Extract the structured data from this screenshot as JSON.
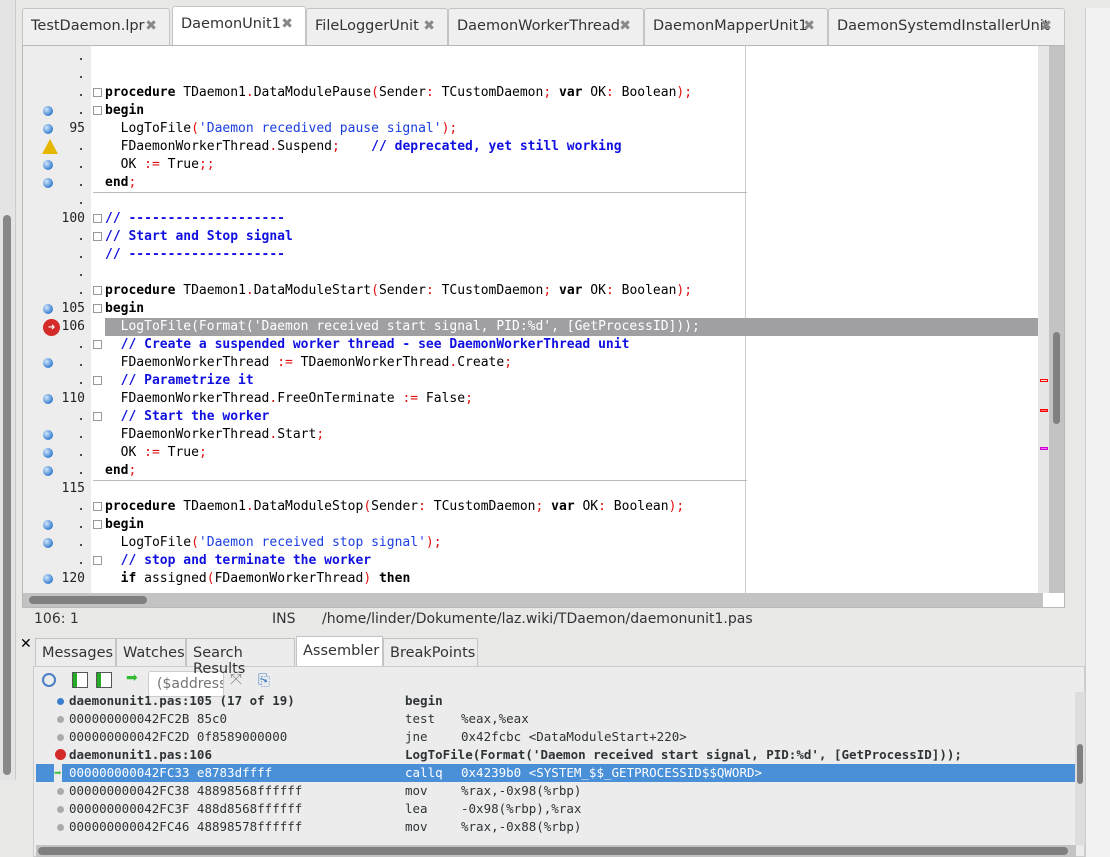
{
  "tabs": [
    {
      "label": "TestDaemon.lpr"
    },
    {
      "label": "DaemonUnit1",
      "active": true
    },
    {
      "label": "FileLoggerUnit"
    },
    {
      "label": "DaemonWorkerThread"
    },
    {
      "label": "DaemonMapperUnit1"
    },
    {
      "label": "DaemonSystemdInstallerUnit"
    }
  ],
  "editor": {
    "lines": [
      {
        "n": ".",
        "m": "",
        "t": []
      },
      {
        "n": ".",
        "m": "",
        "t": []
      },
      {
        "n": ".",
        "m": "",
        "f": 1,
        "t": [
          [
            "kw",
            "procedure"
          ],
          [
            "id",
            " TDaemon1"
          ],
          [
            "sym",
            "."
          ],
          [
            "id",
            "DataModulePause"
          ],
          [
            "sym",
            "("
          ],
          [
            "id",
            "Sender"
          ],
          [
            "sym",
            ":"
          ],
          [
            "id",
            " TCustomDaemon"
          ],
          [
            "sym",
            ";"
          ],
          [
            "kw",
            " var"
          ],
          [
            "id",
            " OK"
          ],
          [
            "sym",
            ":"
          ],
          [
            "id",
            " Boolean"
          ],
          [
            "sym",
            ");"
          ]
        ]
      },
      {
        "n": ".",
        "m": "dot",
        "f": 1,
        "t": [
          [
            "kw",
            "begin"
          ]
        ]
      },
      {
        "n": "95",
        "m": "dot",
        "t": [
          [
            "id",
            "  LogToFile"
          ],
          [
            "sym",
            "("
          ],
          [
            "str",
            "'Daemon recedived pause signal'"
          ],
          [
            "sym",
            ");"
          ]
        ]
      },
      {
        "n": ".",
        "m": "warn",
        "t": [
          [
            "id",
            "  FDaemonWorkerThread"
          ],
          [
            "sym",
            "."
          ],
          [
            "id",
            "Suspend"
          ],
          [
            "sym",
            ";"
          ],
          [
            "id",
            "    "
          ],
          [
            "cmt",
            "// deprecated, yet still working"
          ]
        ]
      },
      {
        "n": ".",
        "m": "dot",
        "t": [
          [
            "id",
            "  OK "
          ],
          [
            "sym",
            ":="
          ],
          [
            "id",
            " True"
          ],
          [
            "sym",
            ";;"
          ]
        ]
      },
      {
        "n": ".",
        "m": "dot",
        "sep": 1,
        "t": [
          [
            "kw",
            "end"
          ],
          [
            "sym",
            ";"
          ]
        ]
      },
      {
        "n": ".",
        "m": "",
        "t": []
      },
      {
        "n": "100",
        "m": "",
        "f": 1,
        "t": [
          [
            "cmt",
            "// --------------------"
          ]
        ]
      },
      {
        "n": ".",
        "m": "",
        "f": 1,
        "t": [
          [
            "cmt",
            "// Start and Stop signal"
          ]
        ]
      },
      {
        "n": ".",
        "m": "",
        "t": [
          [
            "cmt",
            "// --------------------"
          ]
        ]
      },
      {
        "n": ".",
        "m": "",
        "t": []
      },
      {
        "n": ".",
        "m": "",
        "f": 1,
        "t": [
          [
            "kw",
            "procedure"
          ],
          [
            "id",
            " TDaemon1"
          ],
          [
            "sym",
            "."
          ],
          [
            "id",
            "DataModuleStart"
          ],
          [
            "sym",
            "("
          ],
          [
            "id",
            "Sender"
          ],
          [
            "sym",
            ":"
          ],
          [
            "id",
            " TCustomDaemon"
          ],
          [
            "sym",
            ";"
          ],
          [
            "kw",
            " var"
          ],
          [
            "id",
            " OK"
          ],
          [
            "sym",
            ":"
          ],
          [
            "id",
            " Boolean"
          ],
          [
            "sym",
            ");"
          ]
        ]
      },
      {
        "n": "105",
        "m": "dot",
        "f": 1,
        "t": [
          [
            "kw",
            "begin"
          ]
        ]
      },
      {
        "n": "106",
        "m": "bp",
        "hl": 1,
        "t": [
          [
            "id",
            "  LogToFile(Format('Daemon received start signal, PID:%d', [GetProcessID]));"
          ]
        ]
      },
      {
        "n": ".",
        "m": "",
        "f": 1,
        "t": [
          [
            "id",
            "  "
          ],
          [
            "cmt",
            "// Create a suspended worker thread - see DaemonWorkerThread unit"
          ]
        ]
      },
      {
        "n": ".",
        "m": "dot",
        "t": [
          [
            "id",
            "  FDaemonWorkerThread "
          ],
          [
            "sym",
            ":="
          ],
          [
            "id",
            " TDaemonWorkerThread"
          ],
          [
            "sym",
            "."
          ],
          [
            "id",
            "Create"
          ],
          [
            "sym",
            ";"
          ]
        ]
      },
      {
        "n": ".",
        "m": "",
        "f": 1,
        "t": [
          [
            "id",
            "  "
          ],
          [
            "cmt",
            "// Parametrize it"
          ]
        ]
      },
      {
        "n": "110",
        "m": "dot",
        "t": [
          [
            "id",
            "  FDaemonWorkerThread"
          ],
          [
            "sym",
            "."
          ],
          [
            "id",
            "FreeOnTerminate "
          ],
          [
            "sym",
            ":="
          ],
          [
            "id",
            " False"
          ],
          [
            "sym",
            ";"
          ]
        ]
      },
      {
        "n": ".",
        "m": "",
        "f": 1,
        "t": [
          [
            "id",
            "  "
          ],
          [
            "cmt",
            "// Start the worker"
          ]
        ]
      },
      {
        "n": ".",
        "m": "dot",
        "t": [
          [
            "id",
            "  FDaemonWorkerThread"
          ],
          [
            "sym",
            "."
          ],
          [
            "id",
            "Start"
          ],
          [
            "sym",
            ";"
          ]
        ]
      },
      {
        "n": ".",
        "m": "dot",
        "t": [
          [
            "id",
            "  OK "
          ],
          [
            "sym",
            ":="
          ],
          [
            "id",
            " True"
          ],
          [
            "sym",
            ";"
          ]
        ]
      },
      {
        "n": ".",
        "m": "dot",
        "sep": 1,
        "t": [
          [
            "kw",
            "end"
          ],
          [
            "sym",
            ";"
          ]
        ]
      },
      {
        "n": "115",
        "m": "",
        "t": []
      },
      {
        "n": ".",
        "m": "",
        "f": 1,
        "t": [
          [
            "kw",
            "procedure"
          ],
          [
            "id",
            " TDaemon1"
          ],
          [
            "sym",
            "."
          ],
          [
            "id",
            "DataModuleStop"
          ],
          [
            "sym",
            "("
          ],
          [
            "id",
            "Sender"
          ],
          [
            "sym",
            ":"
          ],
          [
            "id",
            " TCustomDaemon"
          ],
          [
            "sym",
            ";"
          ],
          [
            "kw",
            " var"
          ],
          [
            "id",
            " OK"
          ],
          [
            "sym",
            ":"
          ],
          [
            "id",
            " Boolean"
          ],
          [
            "sym",
            ");"
          ]
        ]
      },
      {
        "n": ".",
        "m": "dot",
        "f": 1,
        "t": [
          [
            "kw",
            "begin"
          ]
        ]
      },
      {
        "n": ".",
        "m": "dot",
        "t": [
          [
            "id",
            "  LogToFile"
          ],
          [
            "sym",
            "("
          ],
          [
            "str",
            "'Daemon received stop signal'"
          ],
          [
            "sym",
            ");"
          ]
        ]
      },
      {
        "n": ".",
        "m": "",
        "f": 1,
        "t": [
          [
            "id",
            "  "
          ],
          [
            "cmt",
            "// stop and terminate the worker"
          ]
        ]
      },
      {
        "n": "120",
        "m": "dot",
        "t": [
          [
            "kw",
            "  if"
          ],
          [
            "id",
            " assigned"
          ],
          [
            "sym",
            "("
          ],
          [
            "id",
            "FDaemonWorkerThread"
          ],
          [
            "sym",
            ")"
          ],
          [
            "kw",
            " then"
          ]
        ]
      }
    ]
  },
  "status": {
    "position": "106: 1",
    "mode": "INS",
    "path": "/home/linder/Dokumente/laz.wiki/TDaemon/daemonunit1.pas"
  },
  "bottom_tabs": [
    {
      "label": "Messages"
    },
    {
      "label": "Watches"
    },
    {
      "label": "Search Results"
    },
    {
      "label": "Assembler",
      "active": true
    },
    {
      "label": "BreakPoints"
    }
  ],
  "assembler": {
    "address_placeholder": "($address",
    "rows": [
      {
        "m": "blue",
        "bold": true,
        "a": "daemonunit1.pas:105 (17 of 19)",
        "i": "begin",
        "o": ""
      },
      {
        "m": "gray",
        "a": "000000000042FC2B 85c0",
        "i": "test",
        "o": "%eax,%eax"
      },
      {
        "m": "gray",
        "a": "000000000042FC2D 0f8589000000",
        "i": "jne",
        "o": "0x42fcbc <DataModuleStart+220>"
      },
      {
        "m": "bp",
        "bold": true,
        "a": "daemonunit1.pas:106",
        "i": "LogToFile(Format('Daemon received start signal, PID:%d', [GetProcessID]));",
        "o": ""
      },
      {
        "m": "arrow",
        "sel": true,
        "a": "000000000042FC33 e8783dffff",
        "i": "callq",
        "o": "0x4239b0 <SYSTEM_$$_GETPROCESSID$$QWORD>"
      },
      {
        "m": "gray",
        "a": "000000000042FC38 48898568ffffff",
        "i": "mov",
        "o": "%rax,-0x98(%rbp)"
      },
      {
        "m": "gray",
        "a": "000000000042FC3F 488d8568ffffff",
        "i": "lea",
        "o": "-0x98(%rbp),%rax"
      },
      {
        "m": "gray",
        "a": "000000000042FC46 48898578ffffff",
        "i": "mov",
        "o": "%rax,-0x88(%rbp)"
      }
    ]
  },
  "colors": {
    "selection": "#4a90d9",
    "execution_line": "#a0a0a4",
    "comment": "#1010e0",
    "symbol": "#e01010"
  }
}
